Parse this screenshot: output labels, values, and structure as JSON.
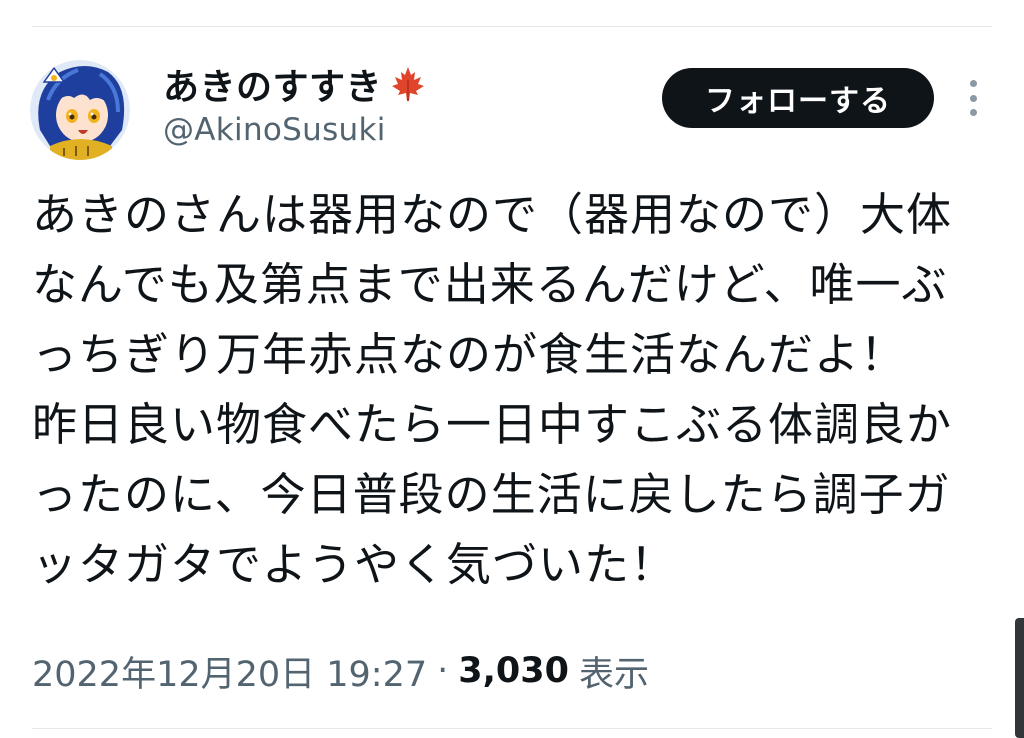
{
  "author": {
    "display_name": "あきのすすき",
    "display_name_emoji": "maple-leaf-icon",
    "handle": "@AkinoSusuki",
    "avatar": "anime-character-avatar"
  },
  "actions": {
    "follow_label": "フォローする",
    "more_icon": "more-vertical-icon"
  },
  "tweet": {
    "lines": [
      "あきのさんは器用なので（器用なので）大体",
      "なんでも及第点まで出来るんだけど、唯一ぶ",
      "っちぎり万年赤点なのが食生活なんだよ！",
      "昨日良い物食べたら一日中すこぶる体調良か",
      "ったのに、今日普段の生活に戻したら調子ガ",
      "ッタガタでようやく気づいた！"
    ]
  },
  "meta": {
    "timestamp": "2022年12月20日 19:27",
    "separator": "·",
    "views_count": "3,030",
    "views_label": "表示"
  },
  "colors": {
    "text_primary": "#0f1419",
    "text_secondary": "#536471",
    "follow_button_bg": "#0f1419",
    "follow_button_text": "#ffffff",
    "maple_leaf": "#e0452b",
    "divider": "#e6e9ec"
  }
}
